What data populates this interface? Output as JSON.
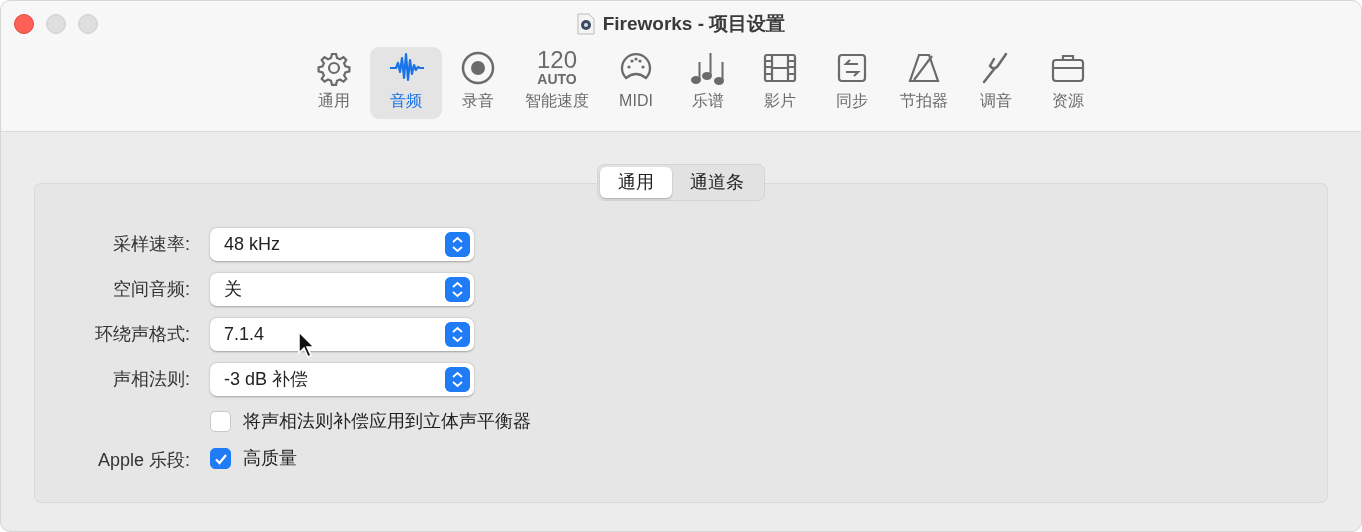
{
  "window": {
    "title": "Fireworks - 项目设置"
  },
  "toolbar": [
    {
      "kind": "gear",
      "label": "通用",
      "selected": false
    },
    {
      "kind": "wave",
      "label": "音频",
      "selected": true
    },
    {
      "kind": "record",
      "label": "录音",
      "selected": false
    },
    {
      "kind": "tempo",
      "tempo": "120",
      "mode": "AUTO",
      "label": "智能速度",
      "selected": false
    },
    {
      "kind": "midi",
      "label": "MIDI",
      "selected": false
    },
    {
      "kind": "notes",
      "label": "乐谱",
      "selected": false
    },
    {
      "kind": "film",
      "label": "影片",
      "selected": false
    },
    {
      "kind": "sync",
      "label": "同步",
      "selected": false
    },
    {
      "kind": "metronome",
      "label": "节拍器",
      "selected": false
    },
    {
      "kind": "fork",
      "label": "调音",
      "selected": false
    },
    {
      "kind": "briefcase",
      "label": "资源",
      "selected": false
    }
  ],
  "segments": [
    {
      "label": "通用",
      "selected": true
    },
    {
      "label": "通道条",
      "selected": false
    }
  ],
  "settings": [
    {
      "kind": "popup",
      "label": "采样速率:",
      "value": "48 kHz"
    },
    {
      "kind": "popup",
      "label": "空间音频:",
      "value": "关"
    },
    {
      "kind": "popup",
      "label": "环绕声格式:",
      "value": "7.1.4"
    },
    {
      "kind": "popup",
      "label": "声相法则:",
      "value": "-3 dB 补偿"
    },
    {
      "kind": "checkbox",
      "text": "将声相法则补偿应用到立体声平衡器",
      "checked": false
    },
    {
      "kind": "checkbox",
      "label": "Apple 乐段:",
      "text": "高质量",
      "checked": true
    }
  ]
}
